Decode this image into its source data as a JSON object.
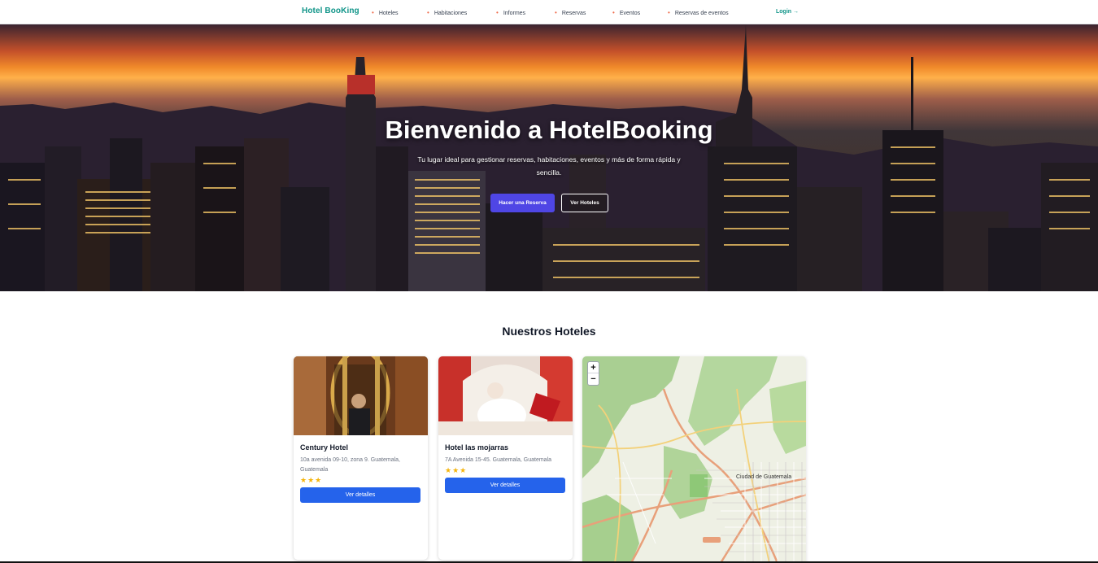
{
  "navbar": {
    "brand": "Hotel BooKing",
    "items": [
      {
        "label": "Hoteles"
      },
      {
        "label": "Habitaciones"
      },
      {
        "label": "Informes"
      },
      {
        "label": "Reservas"
      },
      {
        "label": "Eventos"
      },
      {
        "label": "Reservas de eventos"
      }
    ],
    "login": "Login →"
  },
  "hero": {
    "title": "Bienvenido a HotelBooking",
    "subtitle": "Tu lugar ideal para gestionar reservas, habitaciones, eventos y más de forma rápida y sencilla.",
    "primary_button": "Hacer una Reserva",
    "secondary_button": "Ver Hoteles"
  },
  "hotels_section": {
    "title": "Nuestros Hoteles",
    "hotels": [
      {
        "name": "Century Hotel",
        "address": "10a avenida 09-10, zona 9. Guatemala, Guatemala",
        "stars": 3,
        "stars_text": "★★★",
        "button": "Ver detalles"
      },
      {
        "name": "Hotel las mojarras",
        "address": "7A Avenida 15-45. Guatemala, Guatemala",
        "stars": 3,
        "stars_text": "★★★",
        "button": "Ver detalles"
      }
    ]
  },
  "map": {
    "zoom_in": "+",
    "zoom_out": "−",
    "city_label": "Ciudad de Guatemala"
  },
  "colors": {
    "brand": "#0f9488",
    "primary_button": "#4f46e5",
    "card_button": "#2563eb",
    "star": "#f5b40b",
    "nav_dot": "#ef6a4a"
  }
}
